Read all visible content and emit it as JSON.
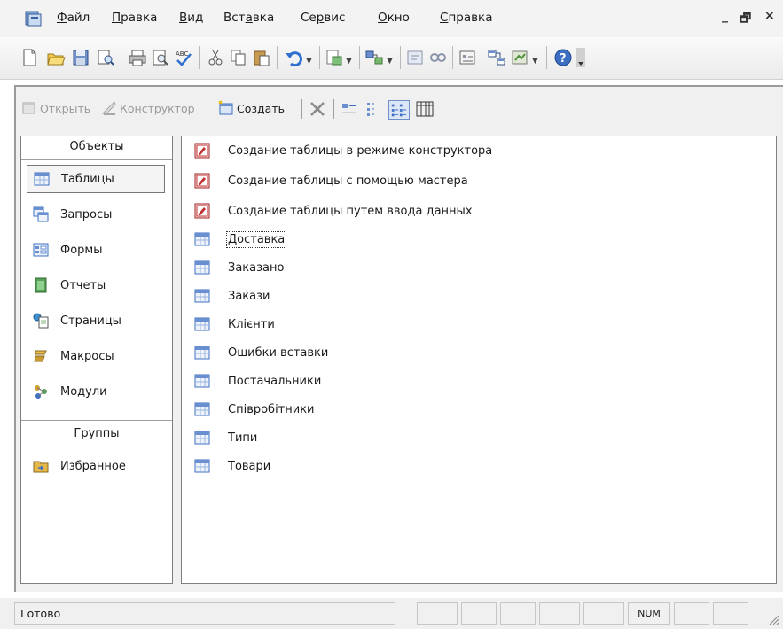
{
  "menubar": {
    "items": [
      {
        "pre": "",
        "u": "Ф",
        "post": "айл"
      },
      {
        "pre": "",
        "u": "П",
        "post": "равка"
      },
      {
        "pre": "",
        "u": "В",
        "post": "ид"
      },
      {
        "pre": "Вст",
        "u": "а",
        "post": "вка"
      },
      {
        "pre": "Се",
        "u": "р",
        "post": "вис"
      },
      {
        "pre": "",
        "u": "О",
        "post": "кно"
      },
      {
        "pre": "",
        "u": "С",
        "post": "правка"
      }
    ],
    "minimize": "_",
    "restore": "🗗",
    "close": "×"
  },
  "db_toolbar": {
    "open": "Открыть",
    "design": "Конструктор",
    "create": "Создать"
  },
  "objects": {
    "header": "Объекты",
    "items": [
      {
        "label": "Таблицы",
        "icon": "table-icon",
        "selected": true
      },
      {
        "label": "Запросы",
        "icon": "query-icon"
      },
      {
        "label": "Формы",
        "icon": "form-icon"
      },
      {
        "label": "Отчеты",
        "icon": "report-icon"
      },
      {
        "label": "Страницы",
        "icon": "page-icon"
      },
      {
        "label": "Макросы",
        "icon": "macro-icon"
      },
      {
        "label": "Модули",
        "icon": "module-icon"
      }
    ],
    "groups_header": "Группы",
    "groups": [
      {
        "label": "Избранное",
        "icon": "favorites-folder-icon"
      }
    ]
  },
  "list": {
    "shortcuts": [
      "Создание таблицы в режиме конструктора",
      "Создание таблицы с помощью мастера",
      "Создание таблицы путем ввода данных"
    ],
    "tables": [
      "Доставка",
      "Заказано",
      "Закази",
      "Клієнти",
      "Ошибки вставки",
      "Постачальники",
      "Співробітники",
      "Типи",
      "Товари"
    ]
  },
  "status": {
    "text": "Готово",
    "num": "NUM"
  },
  "colors": {
    "accent": "#3c6fc2",
    "table_icon": "#6a8fd0"
  }
}
